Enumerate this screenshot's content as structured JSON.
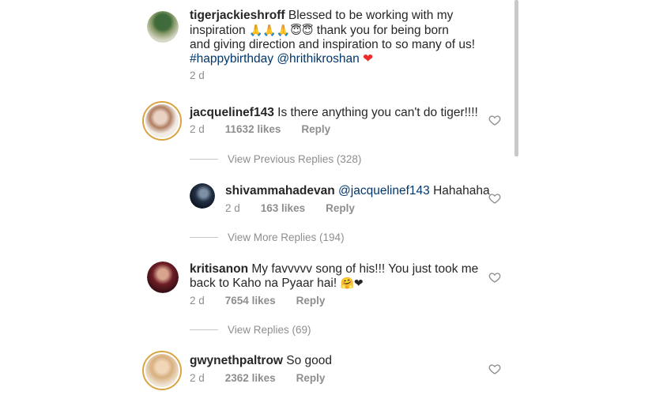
{
  "comments": {
    "caption": {
      "username": "tigerjackieshroff",
      "line1": "Blessed to be working with my",
      "line2_pre": "inspiration ",
      "emojis": "🙏🙏🙏😇😇",
      "line2_post": " thank you for being born",
      "line3": "and giving direction and inspiration to so many of us!",
      "hashtag": "#happybirthday",
      "mention": "@hrithikroshan",
      "heart": "❤",
      "time": "2 d"
    },
    "c1": {
      "username": "jacquelinef143",
      "text": "Is there anything you can't do tiger!!!!",
      "time": "2 d",
      "likes": "11632 likes",
      "reply": "Reply"
    },
    "view_prev": "View Previous Replies (328)",
    "r1": {
      "username": "shivammahadevan",
      "mention": "@jacquelinef143",
      "text": "Hahahaha",
      "time": "2 d",
      "likes": "163 likes",
      "reply": "Reply"
    },
    "view_more": "View More Replies (194)",
    "c2": {
      "username": "kritisanon",
      "line1": "My favvvvv song of his!!! You just took me",
      "line2": "back to Kaho na Pyaar hai!",
      "emojis": "🤗❤",
      "time": "2 d",
      "likes": "7654 likes",
      "reply": "Reply"
    },
    "view_replies": "View Replies (69)",
    "c3": {
      "username": "gwynethpaltrow",
      "text": "So good",
      "time": "2 d",
      "likes": "2362 likes",
      "reply": "Reply"
    }
  },
  "icons": {
    "like": "heart-outline-icon",
    "heart_color": "#ed2b2b"
  }
}
